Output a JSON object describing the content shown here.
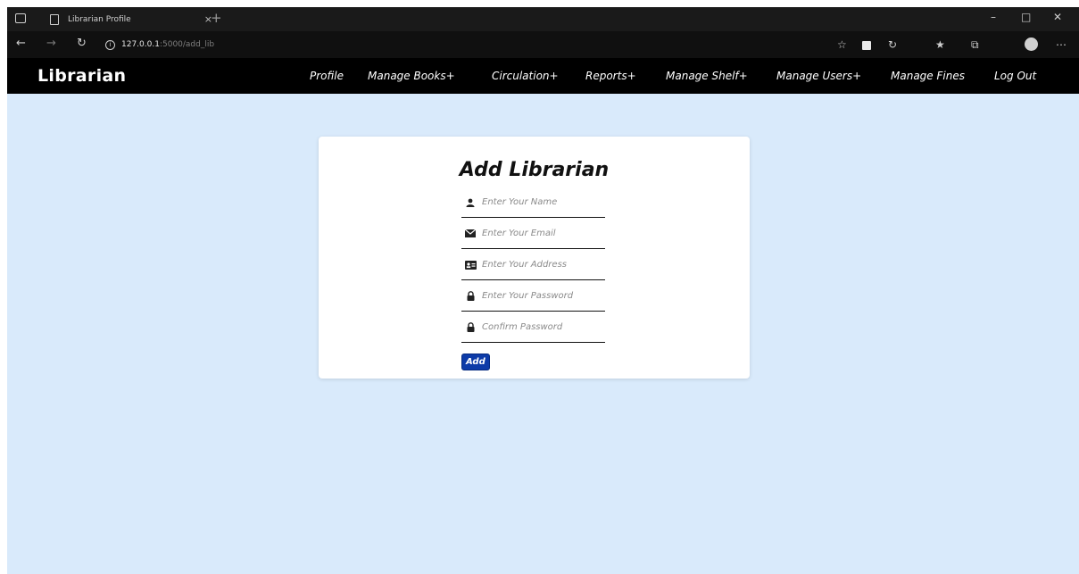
{
  "browser": {
    "tab_title": "Librarian Profile",
    "tab_close": "×",
    "new_tab": "+",
    "url_host": "127.0.0.1",
    "url_path": ":5000/add_lib"
  },
  "navbar": {
    "brand": "Librarian",
    "links": [
      {
        "label": "Profile"
      },
      {
        "label": "Manage Books+"
      },
      {
        "label": "Circulation+"
      },
      {
        "label": "Reports+"
      },
      {
        "label": "Manage Shelf+"
      },
      {
        "label": "Manage Users+"
      },
      {
        "label": "Manage Fines"
      },
      {
        "label": "Log Out"
      }
    ]
  },
  "form": {
    "title": "Add Librarian",
    "fields": [
      {
        "icon": "user-icon",
        "placeholder": "Enter Your Name"
      },
      {
        "icon": "envelope-icon",
        "placeholder": "Enter Your Email"
      },
      {
        "icon": "address-card-icon",
        "placeholder": "Enter Your Address"
      },
      {
        "icon": "lock-icon",
        "placeholder": "Enter Your Password"
      },
      {
        "icon": "lock-icon",
        "placeholder": "Confirm Password"
      }
    ],
    "submit_label": "Add"
  },
  "colors": {
    "page_bg": "#d9eafb",
    "navbar_bg": "#000000",
    "button_bg": "#0d3ba8"
  }
}
